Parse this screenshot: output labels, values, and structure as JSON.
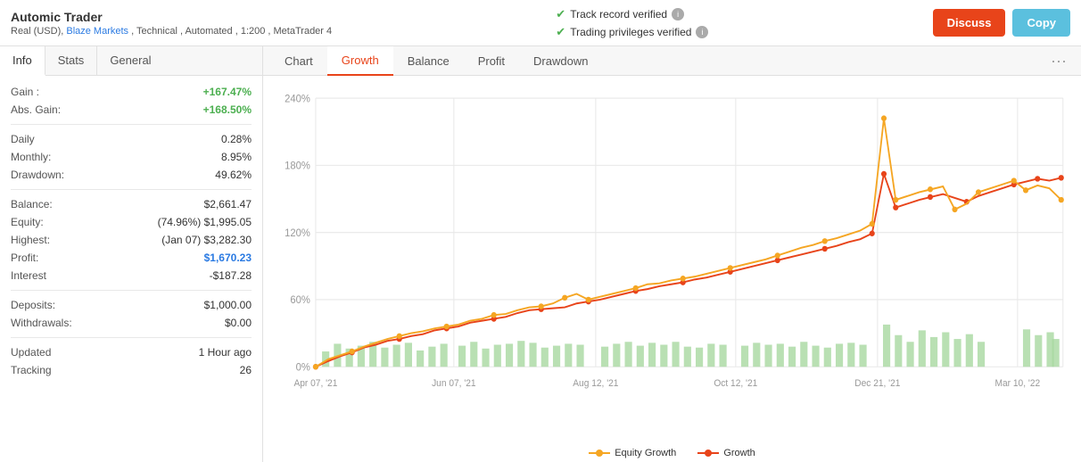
{
  "header": {
    "title": "Automic Trader",
    "subtitle_prefix": "Real (USD),",
    "subtitle_link": "Blaze Markets",
    "subtitle_suffix": ", Technical , Automated , 1:200 , MetaTrader 4",
    "verify1": "Track record verified",
    "verify2": "Trading privileges verified",
    "btn_discuss": "Discuss",
    "btn_copy": "Copy"
  },
  "tabs": {
    "left": [
      {
        "label": "Info",
        "active": true
      },
      {
        "label": "Stats",
        "active": false
      },
      {
        "label": "General",
        "active": false
      }
    ],
    "right": [
      {
        "label": "Chart",
        "active": false
      },
      {
        "label": "Growth",
        "active": true
      },
      {
        "label": "Balance",
        "active": false
      },
      {
        "label": "Profit",
        "active": false
      },
      {
        "label": "Drawdown",
        "active": false
      }
    ]
  },
  "stats": {
    "gain_label": "Gain :",
    "gain_value": "+167.47%",
    "abs_gain_label": "Abs. Gain:",
    "abs_gain_value": "+168.50%",
    "daily_label": "Daily",
    "daily_value": "0.28%",
    "monthly_label": "Monthly:",
    "monthly_value": "8.95%",
    "drawdown_label": "Drawdown:",
    "drawdown_value": "49.62%",
    "balance_label": "Balance:",
    "balance_value": "$2,661.47",
    "equity_label": "Equity:",
    "equity_value": "(74.96%) $1,995.05",
    "highest_label": "Highest:",
    "highest_value": "(Jan 07) $3,282.30",
    "profit_label": "Profit:",
    "profit_value": "$1,670.23",
    "interest_label": "Interest",
    "interest_value": "-$187.28",
    "deposits_label": "Deposits:",
    "deposits_value": "$1,000.00",
    "withdrawals_label": "Withdrawals:",
    "withdrawals_value": "$0.00",
    "updated_label": "Updated",
    "updated_value": "1 Hour ago",
    "tracking_label": "Tracking",
    "tracking_value": "26"
  },
  "chart": {
    "y_labels": [
      "240%",
      "180%",
      "120%",
      "60%",
      "0%"
    ],
    "x_labels": [
      "Apr 07, '21",
      "Jun 07, '21",
      "Aug 12, '21",
      "Oct 12, '21",
      "Dec 21, '21",
      "Mar 10, '22"
    ],
    "legend_equity": "Equity Growth",
    "legend_growth": "Growth"
  }
}
